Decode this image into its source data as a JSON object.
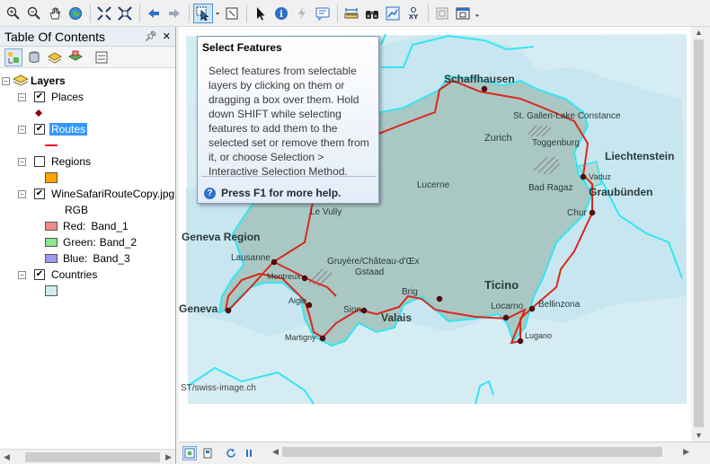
{
  "toolbar": {
    "buttons": [
      "zoom-in-icon",
      "zoom-out-icon",
      "pan-icon",
      "full-extent-icon",
      "fixed-zoom-in-icon",
      "fixed-zoom-out-icon",
      "back-icon",
      "forward-icon",
      "select-features-icon",
      "clear-selection-icon",
      "select-elements-icon",
      "identify-icon",
      "hyperlink-icon",
      "html-popup-icon",
      "measure-icon",
      "find-icon",
      "find-route-icon",
      "go-to-xy-icon",
      "time-slider-icon",
      "viewer-window-icon"
    ],
    "active": "select-features-icon"
  },
  "toc": {
    "title": "Table Of Contents",
    "pin_icon": "pin-icon",
    "close_icon": "close-icon",
    "tabs": [
      "list-by-drawing-order",
      "list-by-source",
      "list-by-visibility",
      "list-by-selection",
      "options"
    ],
    "layers_group": "Layers",
    "layers": [
      {
        "name": "Places",
        "checked": true
      },
      {
        "name": "Routes",
        "checked": true,
        "selected": true
      },
      {
        "name": "Regions",
        "checked": false
      },
      {
        "name": "WineSafariRouteCopy.jpg",
        "checked": true
      },
      {
        "name": "Countries",
        "checked": true
      }
    ],
    "raster": {
      "rgb": "RGB",
      "red": "Red:",
      "red_band": "Band_1",
      "green": "Green:",
      "green_band": "Band_2",
      "blue": "Blue:",
      "blue_band": "Band_3"
    },
    "colors": {
      "places_symbol": "#8b0000",
      "routes_symbol": "#ff0000",
      "regions_fill": "#ffa500",
      "red_swatch": "#f28b8b",
      "green_swatch": "#8be88b",
      "blue_swatch": "#9b9bf2",
      "countries_fill": "#cdeef0"
    }
  },
  "tooltip": {
    "title": "Select Features",
    "body": "Select features from selectable layers by clicking on them or dragging a box over them. Hold down SHIFT while selecting features to add them to the selected set or remove them from it, or choose Selection > Interactive Selection Method.",
    "help": "Press F1 for more help."
  },
  "map": {
    "labels": {
      "schaffhausen": "Schaffhausen",
      "st_gallen": "St. Gallen-Lake Constance",
      "zurich": "Zurich",
      "toggenburg": "Toggenburg",
      "liechtenstein": "Liechtenstein",
      "vaduz": "Vaduz",
      "lucerne": "Lucerne",
      "bad_ragaz": "Bad Ragaz",
      "graubunden": "Graubünden",
      "chur": "Chur",
      "le_vully": "Le Vully",
      "geneva_region": "Geneva Region",
      "lausanne": "Lausanne",
      "gruyere": "Gruyère/Château-d'Œx",
      "gstaad": "Gstaad",
      "montreux": "Montreux",
      "aigle": "Aigle",
      "brig": "Brig",
      "ticino": "Ticino",
      "geneva": "Geneva",
      "sion": "Sion",
      "valais": "Valais",
      "locarno": "Locarno",
      "bellinzona": "Bellinzona",
      "martigny": "Martigny",
      "lugano": "Lugano",
      "credit": "ST/swiss-image.ch"
    },
    "colors": {
      "country_fill": "#a9c8c4",
      "lake_fill": "#c8e6f0",
      "boundary": "#33e6f0",
      "route": "#d9281d",
      "background_image": "#d6ecf3"
    }
  },
  "statusbar": {
    "buttons": [
      "data-view-button",
      "layout-view-button",
      "refresh-button",
      "pause-drawing-button"
    ]
  }
}
